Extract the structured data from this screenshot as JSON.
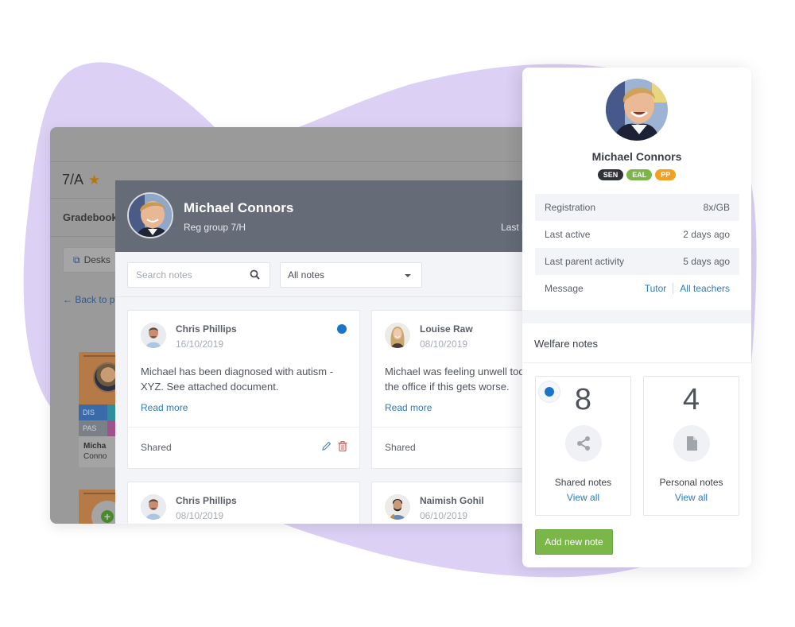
{
  "background_app": {
    "class_title": "7/A",
    "nav_tab": "Gradebook",
    "desks_button": "Desks",
    "back_link": "Back to p",
    "student_tile": {
      "tags": [
        "DIS",
        "",
        "PAS",
        ""
      ],
      "first_name": "Micha",
      "last_name": "Conno"
    }
  },
  "modal": {
    "student_name": "Michael Connors",
    "reg_group": "Reg group 7/H",
    "last_label": "Last l",
    "search": {
      "placeholder": "Search notes"
    },
    "filter": {
      "selected": "All notes"
    },
    "notes": [
      {
        "author": "Chris Phillips",
        "date": "16/10/2019",
        "body": "Michael has been diagnosed with autism -\nXYZ. See attached document.",
        "read_more": "Read more",
        "visibility": "Shared",
        "unread": true,
        "editable": true
      },
      {
        "author": "Louise Raw",
        "date": "08/10/2019",
        "body": "Michael was feeling unwell tod\nthe office if this gets worse.",
        "read_more": "Read more",
        "visibility": "Shared",
        "unread": false,
        "editable": false
      },
      {
        "author": "Chris Phillips",
        "date": "08/10/2019"
      },
      {
        "author": "Naimish Gohil",
        "date": "06/10/2019"
      }
    ]
  },
  "profile": {
    "name": "Michael Connors",
    "badges": [
      {
        "label": "SEN",
        "color": "#2f3236"
      },
      {
        "label": "EAL",
        "color": "#7ab648"
      },
      {
        "label": "PP",
        "color": "#f2a01e"
      }
    ],
    "info": [
      {
        "label": "Registration",
        "value": "8x/GB"
      },
      {
        "label": "Last active",
        "value": "2 days ago"
      },
      {
        "label": "Last parent activity",
        "value": "5 days ago"
      }
    ],
    "message": {
      "label": "Message",
      "links": [
        "Tutor",
        "All teachers"
      ]
    },
    "welfare": {
      "title": "Welfare notes",
      "stats": [
        {
          "count": "8",
          "label": "Shared notes",
          "link": "View all",
          "icon": "share-icon",
          "selected": true
        },
        {
          "count": "4",
          "label": "Personal notes",
          "link": "View all",
          "icon": "document-icon",
          "selected": false
        }
      ],
      "add_button": "Add new note"
    }
  },
  "colors": {
    "accent_blue": "#2b7bc0",
    "unread_dot": "#1a74c9",
    "header_slate": "#656c77",
    "add_green": "#7ab648",
    "blob_lavender": "#dcd1f4"
  }
}
